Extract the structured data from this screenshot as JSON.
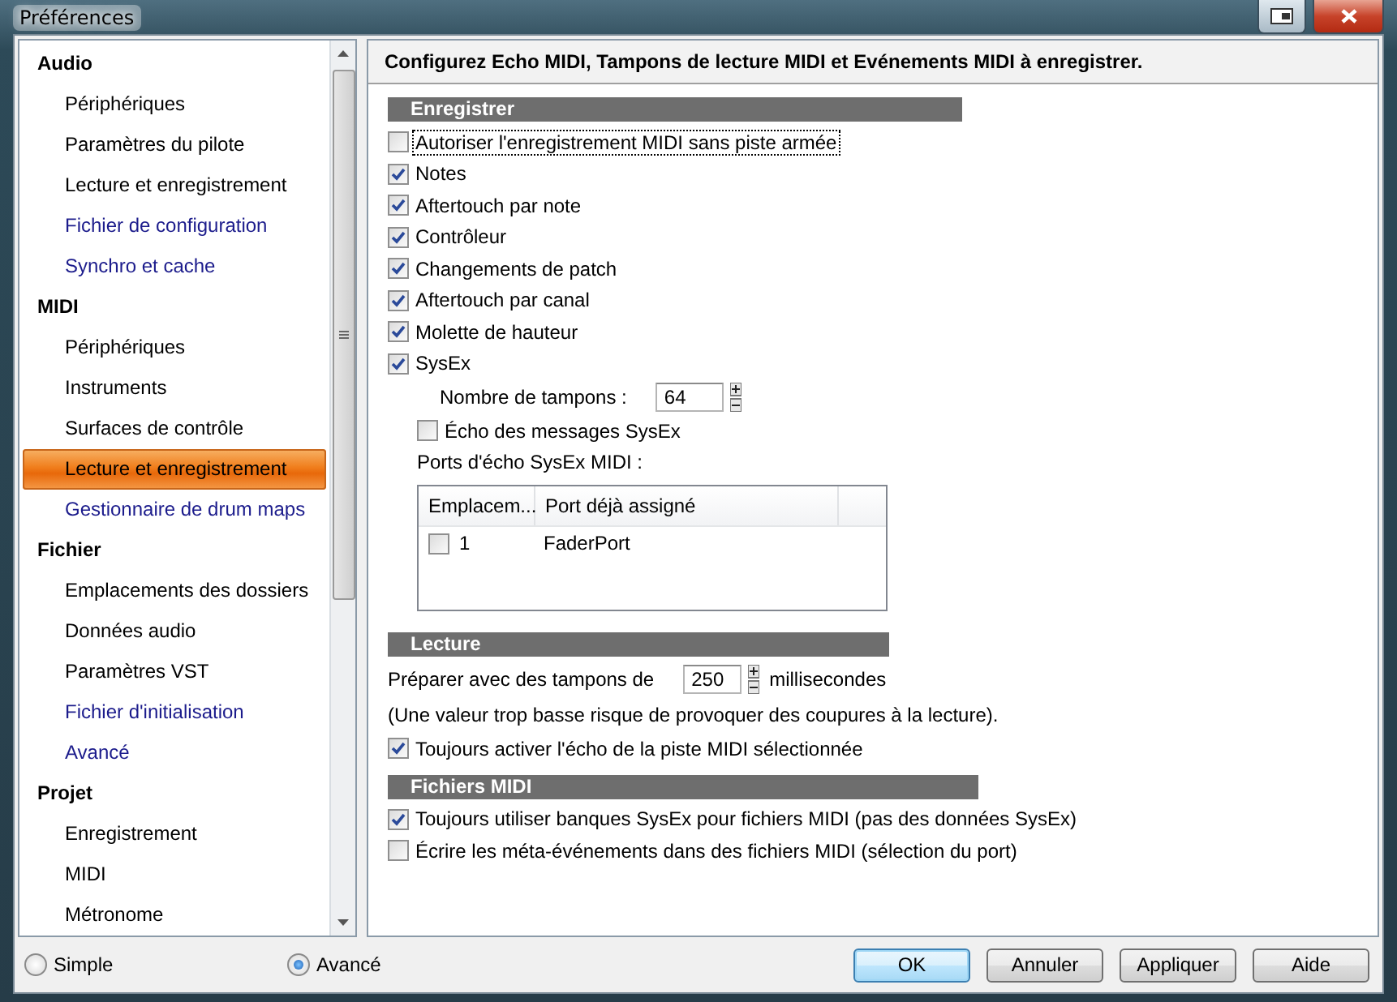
{
  "window": {
    "title": "Préférences"
  },
  "sidebar": {
    "groups": [
      {
        "label": "Audio",
        "children": [
          {
            "label": "Périphériques",
            "selected": false,
            "kind": "page"
          },
          {
            "label": "Paramètres du pilote",
            "selected": false,
            "kind": "page"
          },
          {
            "label": "Lecture et enregistrement",
            "selected": false,
            "kind": "page"
          },
          {
            "label": "Fichier de configuration",
            "selected": false,
            "kind": "link"
          },
          {
            "label": "Synchro et cache",
            "selected": false,
            "kind": "link"
          }
        ]
      },
      {
        "label": "MIDI",
        "children": [
          {
            "label": "Périphériques",
            "selected": false,
            "kind": "page"
          },
          {
            "label": "Instruments",
            "selected": false,
            "kind": "page"
          },
          {
            "label": "Surfaces de contrôle",
            "selected": false,
            "kind": "page"
          },
          {
            "label": "Lecture et enregistrement",
            "selected": true,
            "kind": "page"
          },
          {
            "label": "Gestionnaire de drum maps",
            "selected": false,
            "kind": "link"
          }
        ]
      },
      {
        "label": "Fichier",
        "children": [
          {
            "label": "Emplacements des dossiers",
            "selected": false,
            "kind": "page"
          },
          {
            "label": "Données audio",
            "selected": false,
            "kind": "page"
          },
          {
            "label": "Paramètres VST",
            "selected": false,
            "kind": "page"
          },
          {
            "label": "Fichier d'initialisation",
            "selected": false,
            "kind": "link"
          },
          {
            "label": "Avancé",
            "selected": false,
            "kind": "link"
          }
        ]
      },
      {
        "label": "Projet",
        "children": [
          {
            "label": "Enregistrement",
            "selected": false,
            "kind": "page"
          },
          {
            "label": "MIDI",
            "selected": false,
            "kind": "page"
          },
          {
            "label": "Métronome",
            "selected": false,
            "kind": "page"
          }
        ]
      }
    ]
  },
  "header": "Configurez Echo MIDI, Tampons de lecture MIDI et Evénements MIDI à enregistrer.",
  "sections": [
    {
      "title": "Enregistrer",
      "items": [
        {
          "kind": "checkbox",
          "label": "Autoriser l'enregistrement MIDI sans piste armée",
          "checked": false,
          "focused": true
        },
        {
          "kind": "checkbox",
          "label": "Notes",
          "checked": true
        },
        {
          "kind": "checkbox",
          "label": "Aftertouch par note",
          "checked": true
        },
        {
          "kind": "checkbox",
          "label": "Contrôleur",
          "checked": true
        },
        {
          "kind": "checkbox",
          "label": "Changements de patch",
          "checked": true
        },
        {
          "kind": "checkbox",
          "label": "Aftertouch par canal",
          "checked": true
        },
        {
          "kind": "checkbox",
          "label": "Molette de hauteur",
          "checked": true
        },
        {
          "kind": "checkbox",
          "label": "SysEx",
          "checked": true
        },
        {
          "kind": "sub-spin",
          "label": "Nombre de tampons :",
          "value": "64"
        },
        {
          "kind": "sub-checkbox",
          "label": "Écho des messages SysEx",
          "checked": false
        },
        {
          "kind": "sub-label",
          "label": "Ports d'écho SysEx MIDI :"
        },
        {
          "kind": "table",
          "columns": [
            "Emplacem...",
            "Port déjà assigné"
          ],
          "rows": [
            {
              "checked": false,
              "cells": [
                "1",
                "FaderPort"
              ]
            }
          ]
        }
      ]
    },
    {
      "title": "Lecture",
      "items": [
        {
          "kind": "spin",
          "label": "Préparer avec des tampons de",
          "value": "250",
          "unit": "millisecondes"
        },
        {
          "kind": "note",
          "label": "(Une valeur trop basse risque de provoquer des coupures à la lecture)."
        },
        {
          "kind": "checkbox",
          "label": "Toujours activer l'écho de la piste MIDI sélectionnée",
          "checked": true
        }
      ]
    },
    {
      "title": "Fichiers MIDI",
      "items": [
        {
          "kind": "checkbox",
          "label": "Toujours utiliser banques SysEx pour fichiers MIDI (pas des données SysEx)",
          "checked": true
        },
        {
          "kind": "checkbox",
          "label": "Écrire les méta-événements dans des fichiers MIDI (sélection du port)",
          "checked": false
        }
      ]
    }
  ],
  "modes": [
    {
      "label": "Simple",
      "selected": false
    },
    {
      "label": "Avancé",
      "selected": true
    }
  ],
  "buttons": [
    {
      "label": "OK",
      "default": true
    },
    {
      "label": "Annuler",
      "default": false
    },
    {
      "label": "Appliquer",
      "default": false
    },
    {
      "label": "Aide",
      "default": false
    }
  ]
}
